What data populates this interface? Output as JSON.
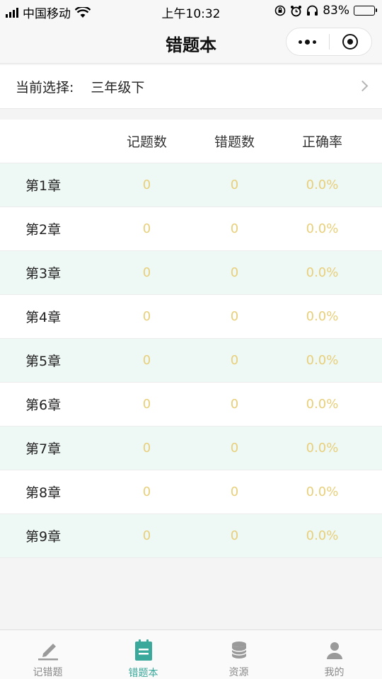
{
  "status_bar": {
    "carrier": "中国移动",
    "time": "上午10:32",
    "battery": "83%",
    "battery_level": 0.83
  },
  "nav": {
    "title": "错题本"
  },
  "selection": {
    "label": "当前选择:",
    "value": "三年级下"
  },
  "table": {
    "headers": [
      "",
      "记题数",
      "错题数",
      "正确率"
    ],
    "rows": [
      {
        "chapter": "第1章",
        "recorded": "0",
        "wrong": "0",
        "accuracy": "0.0%"
      },
      {
        "chapter": "第2章",
        "recorded": "0",
        "wrong": "0",
        "accuracy": "0.0%"
      },
      {
        "chapter": "第3章",
        "recorded": "0",
        "wrong": "0",
        "accuracy": "0.0%"
      },
      {
        "chapter": "第4章",
        "recorded": "0",
        "wrong": "0",
        "accuracy": "0.0%"
      },
      {
        "chapter": "第5章",
        "recorded": "0",
        "wrong": "0",
        "accuracy": "0.0%"
      },
      {
        "chapter": "第6章",
        "recorded": "0",
        "wrong": "0",
        "accuracy": "0.0%"
      },
      {
        "chapter": "第7章",
        "recorded": "0",
        "wrong": "0",
        "accuracy": "0.0%"
      },
      {
        "chapter": "第8章",
        "recorded": "0",
        "wrong": "0",
        "accuracy": "0.0%"
      },
      {
        "chapter": "第9章",
        "recorded": "0",
        "wrong": "0",
        "accuracy": "0.0%"
      }
    ]
  },
  "tabs": [
    {
      "label": "记错题",
      "icon": "pencil-icon",
      "active": false
    },
    {
      "label": "错题本",
      "icon": "notebook-icon",
      "active": true
    },
    {
      "label": "资源",
      "icon": "resource-icon",
      "active": false
    },
    {
      "label": "我的",
      "icon": "user-icon",
      "active": false
    }
  ],
  "colors": {
    "accent": "#3aa89a",
    "number": "#e8cf7a",
    "alt_row": "#eef8f5"
  }
}
